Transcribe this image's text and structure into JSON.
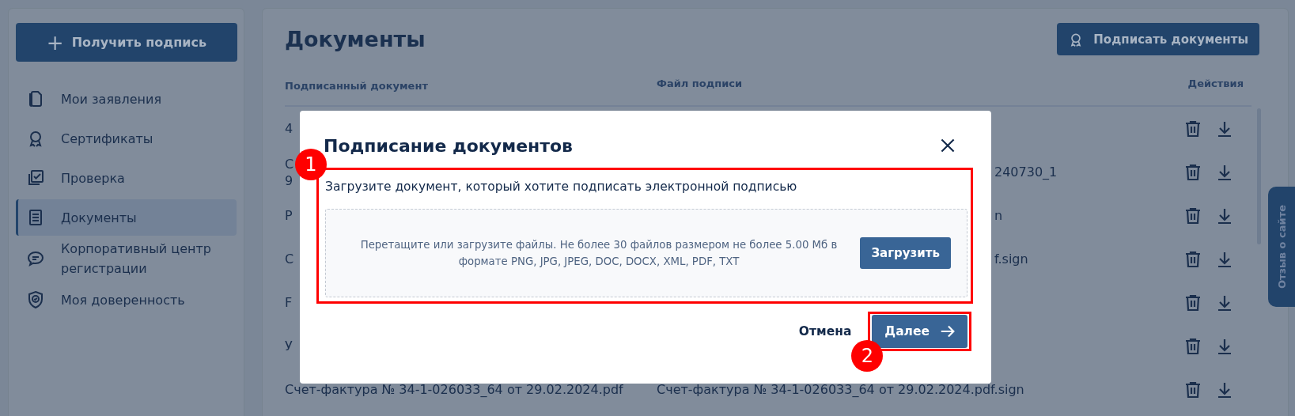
{
  "sidebar": {
    "action_button": {
      "icon": "+",
      "label": "Получить подпись"
    },
    "items": [
      {
        "label": "Мои заявления",
        "selected": false
      },
      {
        "label": "Сертификаты",
        "selected": false
      },
      {
        "label": "Проверка",
        "selected": false
      },
      {
        "label": "Документы",
        "selected": true
      },
      {
        "label": "Корпоративный центр регистрации",
        "selected": false
      },
      {
        "label": "Моя доверенность",
        "selected": false
      }
    ]
  },
  "main": {
    "title": "Документы",
    "sign_button": "Подписать документы",
    "table": {
      "columns": [
        "Подписанный документ",
        "Файл подписи",
        "Действия"
      ],
      "rows": [
        {
          "document": [
            "4"
          ]
        },
        {
          "document": [
            "С",
            "9"
          ],
          "signature": "240730_1"
        },
        {
          "document": [
            "Р"
          ],
          "signature": "n"
        },
        {
          "document": [
            "С"
          ],
          "signature": "f.sign"
        },
        {
          "document": [
            "F"
          ]
        },
        {
          "document": [
            "У"
          ]
        },
        {
          "document": [
            "Счет-фактура № 34-1-026033_64 от 29.02.2024.pdf"
          ],
          "signature": "Счет-фактура № 34-1-026033_64 от 29.02.2024.pdf.sign"
        }
      ]
    }
  },
  "feedback_tab": "Отзыв о сайте",
  "modal": {
    "title": "Подписание документов",
    "instruction": "Загрузите документ, который хотите подписать электронной подписью",
    "dropzone": {
      "text": "Перетащите или загрузите файлы. Не более 30 файлов размером не более 5.00 Мб в формате PNG, JPG, JPEG, DOC, DOCX, XML, PDF, TXT",
      "button": "Загрузить"
    },
    "cancel": "Отмена",
    "next": "Далее"
  },
  "annotations": [
    {
      "number": "1"
    },
    {
      "number": "2"
    }
  ]
}
